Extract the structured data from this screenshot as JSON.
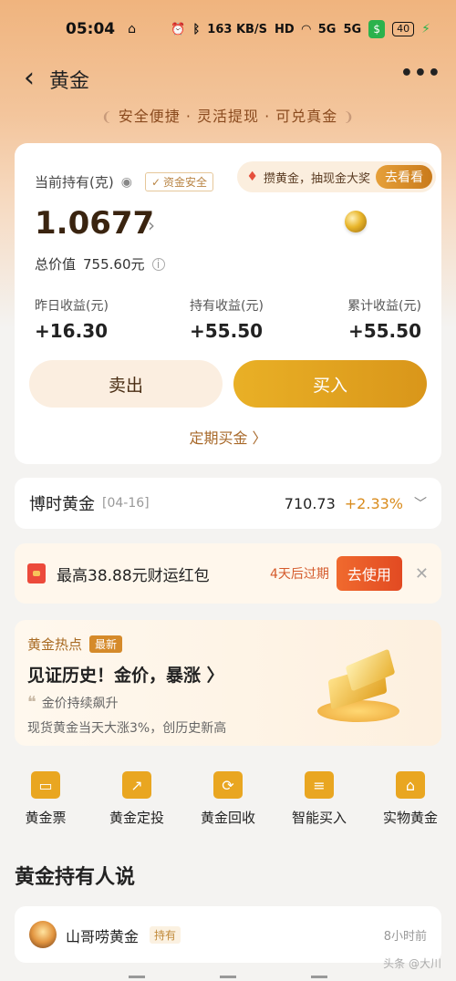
{
  "status_bar": {
    "time": "05:04",
    "speed": "163 KB/S",
    "hd": "HD",
    "signal1": "5G",
    "signal2": "5G",
    "battery": "40"
  },
  "nav": {
    "back_icon": "back-arrow-icon",
    "title": "黄金",
    "more_icon": "more-dots-icon"
  },
  "slogan": "安全便捷 · 灵活提现 · 可兑真金",
  "holding": {
    "label": "当前持有(克)",
    "safe_badge": "资金安全",
    "promo_text": "攒黄金，抽现金大奖",
    "promo_button": "去看看",
    "amount": "1.0677",
    "total_label": "总价值",
    "total_value": "755.60元",
    "stats": [
      {
        "label": "昨日收益(元)",
        "value": "+16.30"
      },
      {
        "label": "持有收益(元)",
        "value": "+55.50"
      },
      {
        "label": "累计收益(元)",
        "value": "+55.50"
      }
    ],
    "sell_button": "卖出",
    "buy_button": "买入",
    "regular_buy": "定期买金 〉"
  },
  "fund": {
    "name": "博时黄金",
    "date": "[04-16]",
    "price": "710.73",
    "change": "+2.33%"
  },
  "coupon": {
    "text": "最高38.88元财运红包",
    "expire": "4天后过期",
    "button": "去使用"
  },
  "hot": {
    "title": "黄金热点",
    "badge": "最新",
    "headline": "见证历史！金价，暴涨 〉",
    "quote": "金价持续飙升",
    "desc": "现货黄金当天大涨3%，创历史新高"
  },
  "menu": [
    {
      "label": "黄金票",
      "icon": "gold-ticket-icon",
      "glyph": "▭"
    },
    {
      "label": "黄金定投",
      "icon": "gold-invest-icon",
      "glyph": "↗"
    },
    {
      "label": "黄金回收",
      "icon": "gold-recycle-icon",
      "glyph": "⟳"
    },
    {
      "label": "智能买入",
      "icon": "smart-buy-icon",
      "glyph": "≡"
    },
    {
      "label": "实物黄金",
      "icon": "physical-gold-icon",
      "glyph": "⌂"
    }
  ],
  "section_title": "黄金持有人说",
  "post": {
    "name": "山哥唠黄金",
    "badge": "持有",
    "time": "8小时前"
  },
  "watermark": "头条 @大川",
  "colors": {
    "accent": "#e9a621",
    "gain": "#d98b1c",
    "buy_button": "#d9961a",
    "coupon_button": "#e24a22"
  }
}
